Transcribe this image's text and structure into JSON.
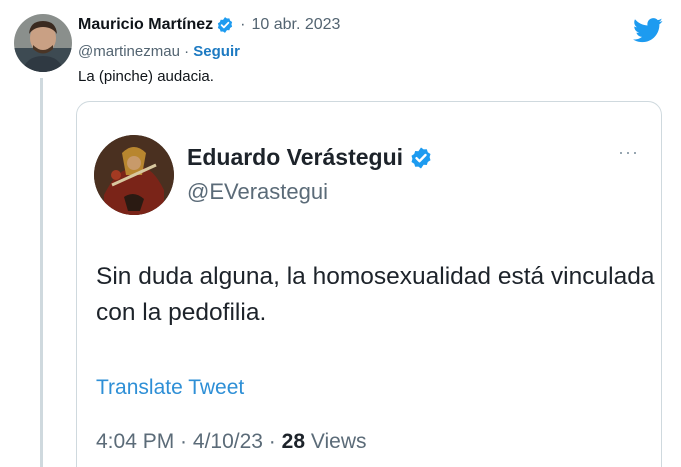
{
  "tweet": {
    "author_name": "Mauricio Martínez",
    "separator": "·",
    "date": "10 abr. 2023",
    "handle": "@martinezmau",
    "handle_separator": " · ",
    "follow_label": "Seguir",
    "text": "La (pinche) audacia.",
    "brand_icon": "twitter-bird-icon",
    "verified_icon": "verified-badge-icon"
  },
  "quoted": {
    "author_name": "Eduardo Verástegui",
    "handle": "@EVerastegui",
    "more_label": "···",
    "text": "Sin duda alguna, la homosexualidad está vinculada con la pedofilia.",
    "translate_label": "Translate Tweet",
    "time": "4:04 PM",
    "meta_separator": " · ",
    "date": "4/10/23",
    "views_count": "28",
    "views_label": "Views"
  },
  "colors": {
    "brand_blue": "#1d9bf0",
    "link_blue": "#1d7ac2",
    "secondary_text": "#536471",
    "border": "#cfd9de"
  }
}
